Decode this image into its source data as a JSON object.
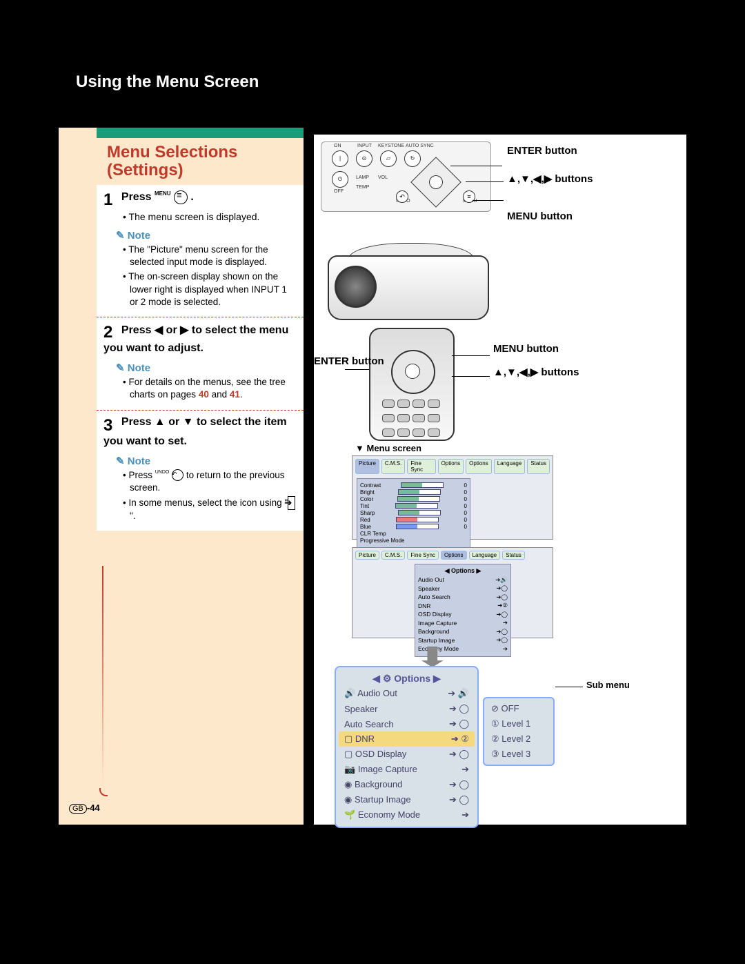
{
  "page_title": "Using the Menu Screen",
  "section_title_line1": "Menu Selections",
  "section_title_line2": "(Settings)",
  "steps": {
    "s1": {
      "num": "1",
      "head_pre": "Press ",
      "head_post": ".",
      "body": "• The menu screen is displayed.",
      "note_label": "Note",
      "note1": "• The \"Picture\" menu screen for the selected input mode is displayed.",
      "note2": "• The on-screen display shown on the lower right is displayed when INPUT 1 or 2 mode is selected."
    },
    "s2": {
      "num": "2",
      "head": "Press ◀ or ▶ to select the menu you want to adjust.",
      "note_label": "Note",
      "note1_a": "• For details on the menus, see the tree charts on pages ",
      "note1_pg1": "40",
      "note1_mid": " and ",
      "note1_pg2": "41",
      "note1_end": "."
    },
    "s3": {
      "num": "3",
      "head": "Press ▲ or ▼ to select the item you want to set.",
      "note_label": "Note",
      "note1_a": "• Press ",
      "note1_b": " to return to the previous screen.",
      "note2_a": "• In some menus, select the icon using \"",
      "note2_b": "\"."
    }
  },
  "labels": {
    "enter_button": "ENTER button",
    "dir_buttons": "▲,▼,◀,▶ buttons",
    "menu_button": "MENU button",
    "enter_button_remote": "ENTER button",
    "menu_button_remote": "MENU button",
    "dir_buttons_remote": "▲,▼,◀,▶ buttons",
    "menu_screen": "Menu screen",
    "sub_menu": "Sub menu"
  },
  "control_panel": {
    "on": "ON",
    "off": "OFF",
    "input": "INPUT",
    "keystone": "KEYSTONE",
    "autosync": "AUTO SYNC",
    "lamp": "LAMP",
    "temp": "TEMP",
    "vol": "VOL",
    "undo": "UNDO",
    "menu": "MENU"
  },
  "osd1": {
    "tabs": [
      "Picture",
      "C.M.S.",
      "Fine Sync",
      "Options",
      "Options",
      "Language",
      "Status"
    ],
    "rows": [
      {
        "k": "Contrast",
        "v": "0"
      },
      {
        "k": "Bright",
        "v": "0"
      },
      {
        "k": "Color",
        "v": "0"
      },
      {
        "k": "Tint",
        "v": "0"
      },
      {
        "k": "Sharp",
        "v": "0"
      },
      {
        "k": "Red",
        "v": "0"
      },
      {
        "k": "Blue",
        "v": "0"
      }
    ],
    "extra1": "CLR Temp",
    "extra2": "Progressive Mode"
  },
  "osd2": {
    "tabs": [
      "Picture",
      "C.M.S.",
      "Fine Sync",
      "Options",
      "Language",
      "Status"
    ],
    "title": "Options",
    "rows": [
      "Audio Out",
      "Speaker",
      "Auto Search",
      "DNR",
      "OSD Display",
      "Image Capture",
      "Background",
      "Startup Image",
      "Economy Mode"
    ]
  },
  "options_big": {
    "title": "Options",
    "rows": [
      "Audio Out",
      "Speaker",
      "Auto Search",
      "DNR",
      "OSD Display",
      "Image Capture",
      "Background",
      "Startup Image",
      "Economy Mode"
    ],
    "highlight_index": 3
  },
  "sub_menu": {
    "rows": [
      "OFF",
      "Level 1",
      "Level 2",
      "Level 3"
    ]
  },
  "footer": {
    "gb": "GB",
    "page": "-44"
  }
}
